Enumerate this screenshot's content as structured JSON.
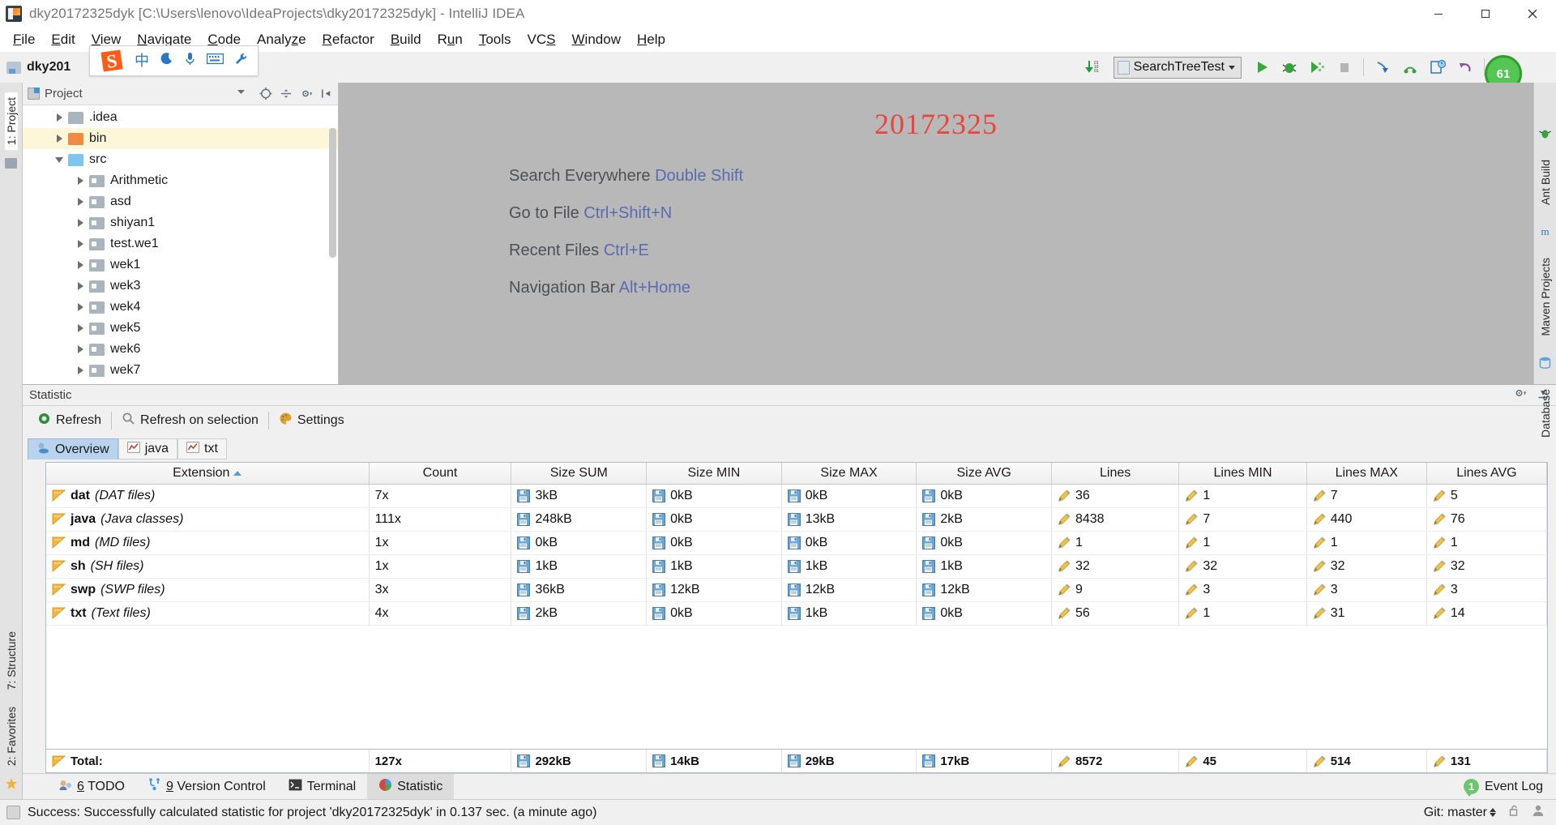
{
  "window": {
    "title": "dky20172325dyk [C:\\Users\\lenovo\\IdeaProjects\\dky20172325dyk] - IntelliJ IDEA",
    "minimize_label": "Minimize",
    "maximize_label": "Maximize",
    "close_label": "Close"
  },
  "menu": {
    "items": [
      {
        "label": "File",
        "mnemonic": "F"
      },
      {
        "label": "Edit",
        "mnemonic": "E"
      },
      {
        "label": "View",
        "mnemonic": "V"
      },
      {
        "label": "Navigate",
        "mnemonic": "N"
      },
      {
        "label": "Code",
        "mnemonic": "C"
      },
      {
        "label": "Analyze",
        "mnemonic": "z"
      },
      {
        "label": "Refactor",
        "mnemonic": "R"
      },
      {
        "label": "Build",
        "mnemonic": "B"
      },
      {
        "label": "Run",
        "mnemonic": "u"
      },
      {
        "label": "Tools",
        "mnemonic": "T"
      },
      {
        "label": "VCS",
        "mnemonic": "S"
      },
      {
        "label": "Window",
        "mnemonic": "W"
      },
      {
        "label": "Help",
        "mnemonic": "H"
      }
    ]
  },
  "toolbar": {
    "breadcrumb": "dky201",
    "ime": {
      "logo": "sogou-s-icon",
      "mode_label": "中",
      "moon_icon": "moon-icon",
      "mic_icon": "microphone-icon",
      "keyboard_icon": "keyboard-icon",
      "wrench_icon": "wrench-icon"
    },
    "run_config": "SearchTreeTest",
    "progress_value": "61",
    "icons": [
      "update-project-icon",
      "run-icon",
      "debug-icon",
      "run-coverage-icon",
      "stop-icon",
      "step-into-icon",
      "step-out-icon",
      "profiler-icon",
      "revert-icon",
      "project-structure-icon"
    ]
  },
  "left_rail": {
    "project_label": "1: Project",
    "structure_label": "7: Structure",
    "favorites_label": "2: Favorites"
  },
  "right_rail": {
    "ant_label": "Ant Build",
    "maven_label": "Maven Projects",
    "database_label": "Database"
  },
  "project_panel": {
    "title": "Project",
    "tree": [
      {
        "label": ".idea",
        "depth": 0,
        "state": "collapsed",
        "icon": "folder-gray",
        "highlighted": false
      },
      {
        "label": "bin",
        "depth": 0,
        "state": "collapsed",
        "icon": "folder-orange",
        "highlighted": true
      },
      {
        "label": "src",
        "depth": 0,
        "state": "expanded",
        "icon": "folder-blue",
        "highlighted": false
      },
      {
        "label": "Arithmetic",
        "depth": 1,
        "state": "collapsed",
        "icon": "package",
        "highlighted": false
      },
      {
        "label": "asd",
        "depth": 1,
        "state": "collapsed",
        "icon": "package",
        "highlighted": false
      },
      {
        "label": "shiyan1",
        "depth": 1,
        "state": "collapsed",
        "icon": "package",
        "highlighted": false
      },
      {
        "label": "test.we1",
        "depth": 1,
        "state": "collapsed",
        "icon": "package",
        "highlighted": false
      },
      {
        "label": "wek1",
        "depth": 1,
        "state": "collapsed",
        "icon": "package",
        "highlighted": false
      },
      {
        "label": "wek3",
        "depth": 1,
        "state": "collapsed",
        "icon": "package",
        "highlighted": false
      },
      {
        "label": "wek4",
        "depth": 1,
        "state": "collapsed",
        "icon": "package",
        "highlighted": false
      },
      {
        "label": "wek5",
        "depth": 1,
        "state": "collapsed",
        "icon": "package",
        "highlighted": false
      },
      {
        "label": "wek6",
        "depth": 1,
        "state": "collapsed",
        "icon": "package",
        "highlighted": false
      },
      {
        "label": "wek7",
        "depth": 1,
        "state": "collapsed",
        "icon": "package",
        "highlighted": false
      }
    ]
  },
  "editor": {
    "watermark": "20172325",
    "watermark_color": "#e8453c",
    "tips": [
      {
        "action": "Search Everywhere",
        "shortcut": "Double Shift"
      },
      {
        "action": "Go to File",
        "shortcut": "Ctrl+Shift+N"
      },
      {
        "action": "Recent Files",
        "shortcut": "Ctrl+E"
      },
      {
        "action": "Navigation Bar",
        "shortcut": "Alt+Home"
      }
    ]
  },
  "statistic": {
    "panel_title": "Statistic",
    "toolbar": {
      "refresh": "Refresh",
      "refresh_on_selection": "Refresh on selection",
      "settings": "Settings"
    },
    "tabs": [
      {
        "label": "Overview",
        "active": true,
        "icon": "overview-icon"
      },
      {
        "label": "java",
        "active": false,
        "icon": "chart-icon"
      },
      {
        "label": "txt",
        "active": false,
        "icon": "chart-icon"
      }
    ],
    "columns": [
      "Extension",
      "Count",
      "Size SUM",
      "Size MIN",
      "Size MAX",
      "Size AVG",
      "Lines",
      "Lines MIN",
      "Lines MAX",
      "Lines AVG"
    ],
    "sorted_column": "Extension",
    "sort_direction": "asc",
    "rows": [
      {
        "ext": "dat",
        "desc": "(DAT files)",
        "count": "7x",
        "size_sum": "3kB",
        "size_min": "0kB",
        "size_max": "0kB",
        "size_avg": "0kB",
        "lines": "36",
        "lines_min": "1",
        "lines_max": "7",
        "lines_avg": "5"
      },
      {
        "ext": "java",
        "desc": "(Java classes)",
        "count": "111x",
        "size_sum": "248kB",
        "size_min": "0kB",
        "size_max": "13kB",
        "size_avg": "2kB",
        "lines": "8438",
        "lines_min": "7",
        "lines_max": "440",
        "lines_avg": "76"
      },
      {
        "ext": "md",
        "desc": "(MD files)",
        "count": "1x",
        "size_sum": "0kB",
        "size_min": "0kB",
        "size_max": "0kB",
        "size_avg": "0kB",
        "lines": "1",
        "lines_min": "1",
        "lines_max": "1",
        "lines_avg": "1"
      },
      {
        "ext": "sh",
        "desc": "(SH files)",
        "count": "1x",
        "size_sum": "1kB",
        "size_min": "1kB",
        "size_max": "1kB",
        "size_avg": "1kB",
        "lines": "32",
        "lines_min": "32",
        "lines_max": "32",
        "lines_avg": "32"
      },
      {
        "ext": "swp",
        "desc": "(SWP files)",
        "count": "3x",
        "size_sum": "36kB",
        "size_min": "12kB",
        "size_max": "12kB",
        "size_avg": "12kB",
        "lines": "9",
        "lines_min": "3",
        "lines_max": "3",
        "lines_avg": "3"
      },
      {
        "ext": "txt",
        "desc": "(Text files)",
        "count": "4x",
        "size_sum": "2kB",
        "size_min": "0kB",
        "size_max": "1kB",
        "size_avg": "0kB",
        "lines": "56",
        "lines_min": "1",
        "lines_max": "31",
        "lines_avg": "14"
      }
    ],
    "total": {
      "label": "Total:",
      "count": "127x",
      "size_sum": "292kB",
      "size_min": "14kB",
      "size_max": "29kB",
      "size_avg": "17kB",
      "lines": "8572",
      "lines_min": "45",
      "lines_max": "514",
      "lines_avg": "131"
    }
  },
  "bottom_tabs": [
    {
      "label": "6: TODO",
      "mnemonic": "6",
      "text": " TODO",
      "active": false,
      "icon": "todo-icon"
    },
    {
      "label": "9: Version Control",
      "mnemonic": "9",
      "text": " Version Control",
      "active": false,
      "icon": "vcs-icon"
    },
    {
      "label": "Terminal",
      "mnemonic": "",
      "text": "Terminal",
      "active": false,
      "icon": "terminal-icon"
    },
    {
      "label": "Statistic",
      "mnemonic": "",
      "text": "Statistic",
      "active": true,
      "icon": "statistic-icon"
    }
  ],
  "event_log": {
    "count": "1",
    "label": "Event Log"
  },
  "status_bar": {
    "message": "Success: Successfully calculated statistic for project 'dky20172325dyk' in 0.137 sec. (a minute ago)",
    "git_branch": "Git: master",
    "lock_icon": "unlock-icon",
    "user_icon": "user-icon"
  }
}
